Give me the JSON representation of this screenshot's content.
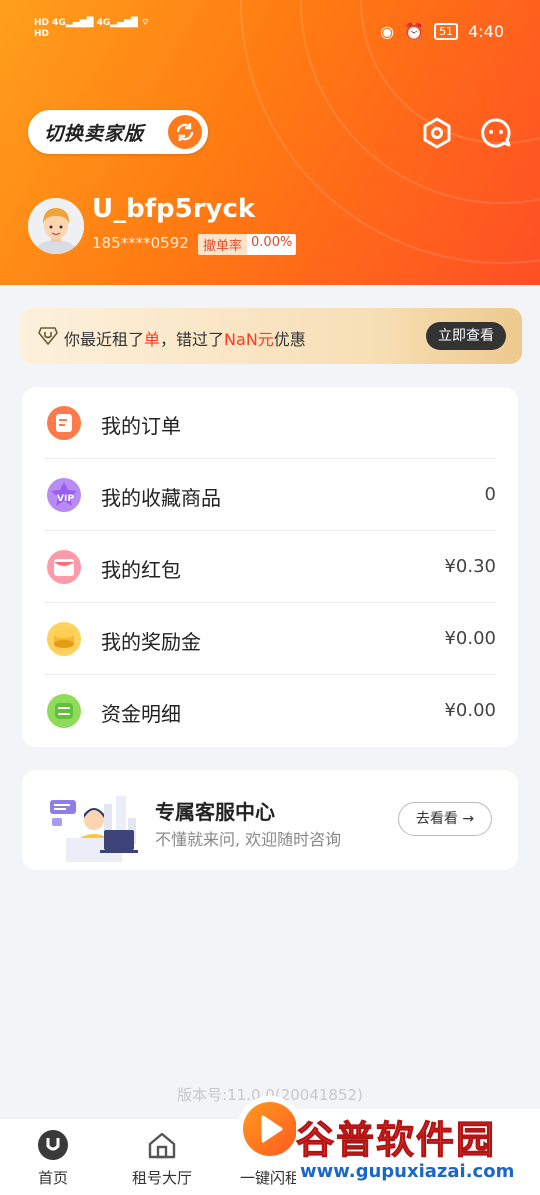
{
  "status_bar": {
    "left_tags": [
      "HD",
      "HD"
    ],
    "network": "4G",
    "battery": "51",
    "time": "4:40"
  },
  "header": {
    "switch_button_label": "切换卖家版",
    "username": "U_bfp5ryck",
    "phone": "185****0592",
    "cancel_rate_label": "撤单率",
    "cancel_rate_value": "0.00%"
  },
  "promo": {
    "text_part1": "你最近租了",
    "text_highlight1": "单",
    "text_part2": "，错过了",
    "text_highlight2": "NaN元",
    "text_part3": "优惠",
    "button_label": "立即查看"
  },
  "menu": {
    "items": [
      {
        "label": "我的订单",
        "value": ""
      },
      {
        "label": "我的收藏商品",
        "value": "0"
      },
      {
        "label": "我的红包",
        "value": "¥0.30"
      },
      {
        "label": "我的奖励金",
        "value": "¥0.00"
      },
      {
        "label": "资金明细",
        "value": "¥0.00"
      }
    ]
  },
  "service": {
    "title": "专属客服中心",
    "subtitle": "不懂就来问, 欢迎随时咨询",
    "button_label": "去看看"
  },
  "version_text": "版本号:11.0.0(20041852)",
  "tabbar": {
    "items": [
      {
        "label": "首页"
      },
      {
        "label": "租号大厅"
      },
      {
        "label": "一键闪租"
      }
    ]
  },
  "watermark": {
    "title": "谷普软件园",
    "url": "www.gupuxiazai.com"
  },
  "colors": {
    "header_start": "#ff9f1c",
    "header_end": "#ff4f25",
    "accent_red": "#ff3b1f"
  }
}
